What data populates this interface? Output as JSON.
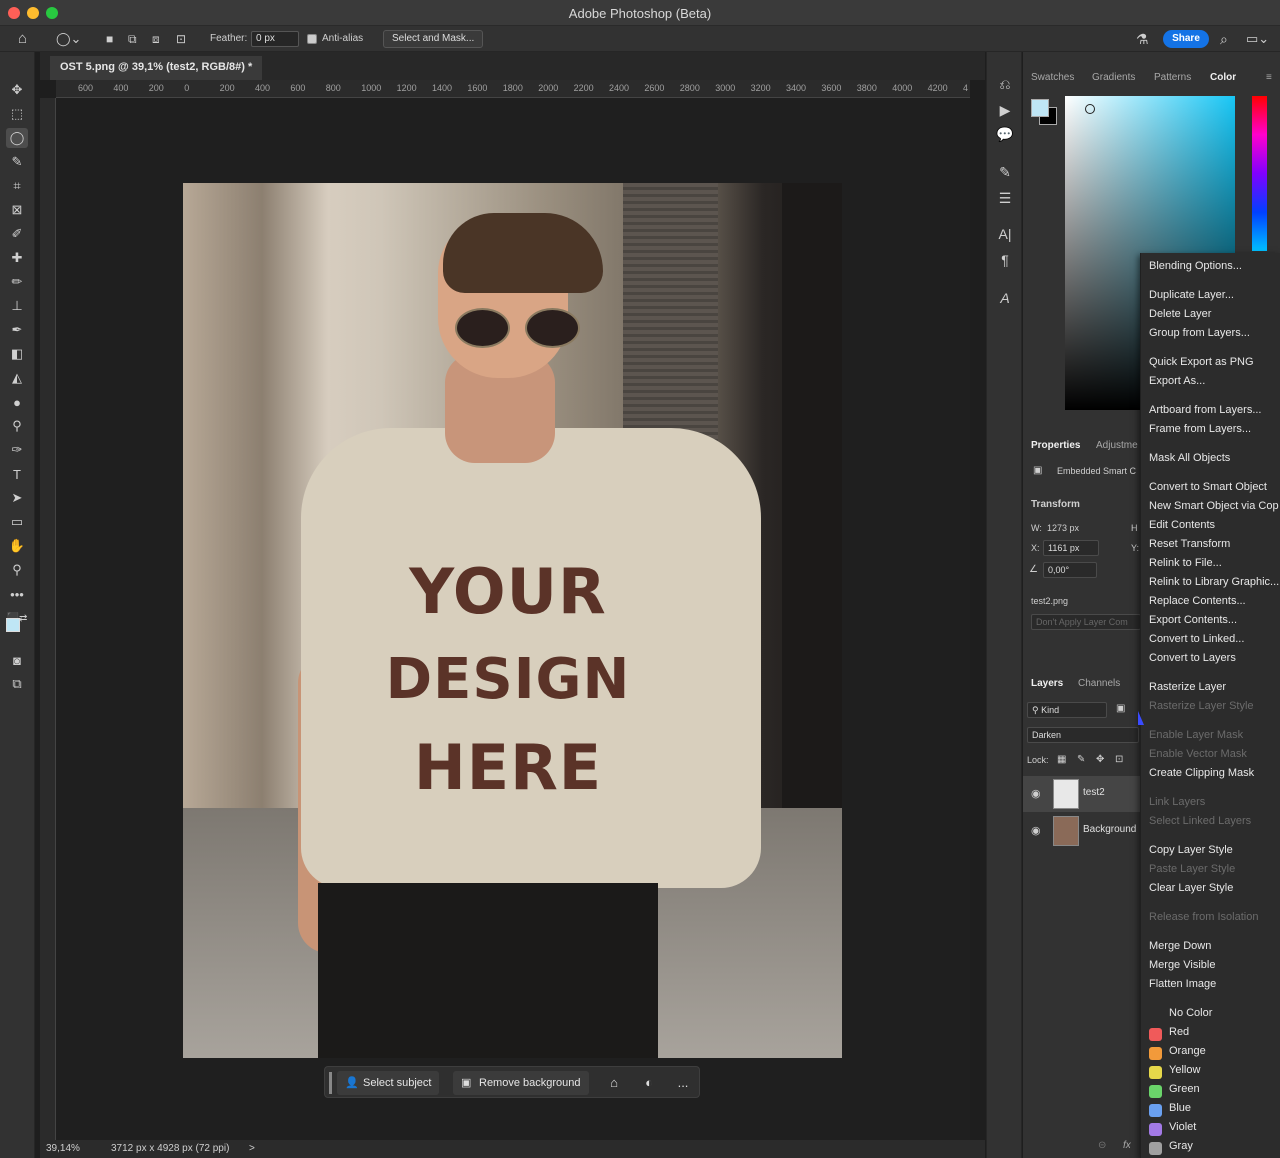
{
  "app": {
    "title": "Adobe Photoshop (Beta)"
  },
  "options_bar": {
    "feather_label": "Feather:",
    "feather_value": "0 px",
    "antialias_label": "Anti-alias",
    "select_mask_label": "Select and Mask...",
    "share_label": "Share"
  },
  "document": {
    "tab_title": "OST 5.png @ 39,1% (test2, RGB/8#) *",
    "ruler_ticks": [
      "600",
      "400",
      "200",
      "0",
      "200",
      "400",
      "600",
      "800",
      "1000",
      "1200",
      "1400",
      "1600",
      "1800",
      "2000",
      "2200",
      "2400",
      "2600",
      "2800",
      "3000",
      "3200",
      "3400",
      "3600",
      "3800",
      "4000",
      "4200",
      "4"
    ],
    "shirt_text": [
      "YOUR",
      "DESIGN",
      "HERE"
    ]
  },
  "taskbar": {
    "select_subject": "Select subject",
    "remove_background": "Remove background",
    "more": "..."
  },
  "status": {
    "zoom": "39,14%",
    "dimensions": "3712 px x 4928 px (72 ppi)",
    "arrow": ">"
  },
  "panels": {
    "top_tabs": [
      "Swatches",
      "Gradients",
      "Patterns",
      "Color"
    ],
    "properties_tabs": [
      "Properties",
      "Adjustme"
    ],
    "embedded_label": "Embedded Smart C",
    "transform_label": "Transform",
    "w_label": "W:",
    "w_value": "1273 px",
    "h_label": "H",
    "x_label": "X:",
    "x_value": "1161 px",
    "y_label": "Y:",
    "angle_value": "0,00°",
    "file_name": "test2.png",
    "dont_apply": "Don't Apply Layer Com",
    "layers_tabs": [
      "Layers",
      "Channels"
    ],
    "kind_label": "Kind",
    "blend_mode": "Darken",
    "lock_label": "Lock:",
    "layers": [
      {
        "name": "test2",
        "selected": true
      },
      {
        "name": "Background",
        "selected": false
      }
    ]
  },
  "context_menu": {
    "items": [
      {
        "label": "Blending Options...",
        "disabled": false
      },
      {
        "label": "Duplicate Layer...",
        "disabled": false
      },
      {
        "label": "Delete Layer",
        "disabled": false
      },
      {
        "label": "Group from Layers...",
        "disabled": false
      },
      {
        "label": "Quick Export as PNG",
        "disabled": false
      },
      {
        "label": "Export As...",
        "disabled": false
      },
      {
        "label": "Artboard from Layers...",
        "disabled": false
      },
      {
        "label": "Frame from Layers...",
        "disabled": false
      },
      {
        "label": "Mask All Objects",
        "disabled": false
      },
      {
        "label": "Convert to Smart Object",
        "disabled": false
      },
      {
        "label": "New Smart Object via Cop",
        "disabled": false
      },
      {
        "label": "Edit Contents",
        "disabled": false
      },
      {
        "label": "Reset Transform",
        "disabled": false
      },
      {
        "label": "Relink to File...",
        "disabled": false
      },
      {
        "label": "Relink to Library Graphic...",
        "disabled": false
      },
      {
        "label": "Replace Contents...",
        "disabled": false
      },
      {
        "label": "Export Contents...",
        "disabled": false
      },
      {
        "label": "Convert to Linked...",
        "disabled": false
      },
      {
        "label": "Convert to Layers",
        "disabled": false
      },
      {
        "label": "Rasterize Layer",
        "disabled": false
      },
      {
        "label": "Rasterize Layer Style",
        "disabled": true
      },
      {
        "label": "Enable Layer Mask",
        "disabled": true
      },
      {
        "label": "Enable Vector Mask",
        "disabled": true
      },
      {
        "label": "Create Clipping Mask",
        "disabled": false
      },
      {
        "label": "Link Layers",
        "disabled": true
      },
      {
        "label": "Select Linked Layers",
        "disabled": true
      },
      {
        "label": "Copy Layer Style",
        "disabled": false
      },
      {
        "label": "Paste Layer Style",
        "disabled": true
      },
      {
        "label": "Clear Layer Style",
        "disabled": false
      },
      {
        "label": "Release from Isolation",
        "disabled": true
      },
      {
        "label": "Merge Down",
        "disabled": false
      },
      {
        "label": "Merge Visible",
        "disabled": false
      },
      {
        "label": "Flatten Image",
        "disabled": false
      }
    ],
    "colors": [
      {
        "label": "No Color",
        "hex": ""
      },
      {
        "label": "Red",
        "hex": "#f05a5a"
      },
      {
        "label": "Orange",
        "hex": "#f29a3a"
      },
      {
        "label": "Yellow",
        "hex": "#e6d84a"
      },
      {
        "label": "Green",
        "hex": "#6ad46a"
      },
      {
        "label": "Blue",
        "hex": "#6aa0f0"
      },
      {
        "label": "Violet",
        "hex": "#a37ae6"
      },
      {
        "label": "Gray",
        "hex": "#a0a0a0"
      }
    ]
  },
  "colors": {
    "accent": "#1473e6",
    "foreground_swatch": "#bfe6f5",
    "background_swatch": "#000000"
  }
}
